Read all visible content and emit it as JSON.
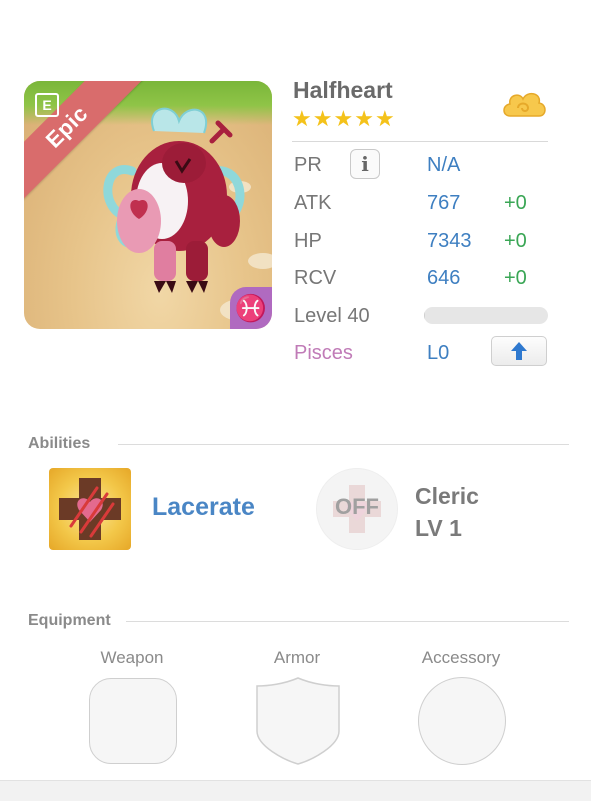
{
  "portrait": {
    "rarity_label": "Epic",
    "calendar_icon_glyph": "E",
    "zodiac_glyph": "♓",
    "colors": {
      "ribbon": "#d96c6c",
      "zodiac_badge": "#b06ac0"
    }
  },
  "monster": {
    "name": "Halfheart",
    "stars": 5,
    "star_glyph": "★"
  },
  "stats": {
    "pr_label": "PR",
    "pr_info_glyph": "i",
    "pr_value": "N/A",
    "atk_label": "ATK",
    "atk_value": "767",
    "atk_bonus": "+0",
    "hp_label": "HP",
    "hp_value": "7343",
    "hp_bonus": "+0",
    "rcv_label": "RCV",
    "rcv_value": "646",
    "rcv_bonus": "+0",
    "level_label": "Level 40",
    "level_progress": 0.01,
    "sign_label": "Pisces",
    "sign_level": "L0"
  },
  "abilities": {
    "title": "Abilities",
    "primary_name": "Lacerate",
    "secondary_state": "OFF",
    "secondary_name": "Cleric",
    "secondary_level": "LV 1"
  },
  "equipment": {
    "title": "Equipment",
    "slots": [
      {
        "label": "Weapon"
      },
      {
        "label": "Armor"
      },
      {
        "label": "Accessory"
      }
    ]
  },
  "colors": {
    "accent_blue": "#3e7fc1",
    "bonus_green": "#3aa655",
    "pisces_pink": "#c07bb7",
    "star_gold": "#f4c21a"
  }
}
